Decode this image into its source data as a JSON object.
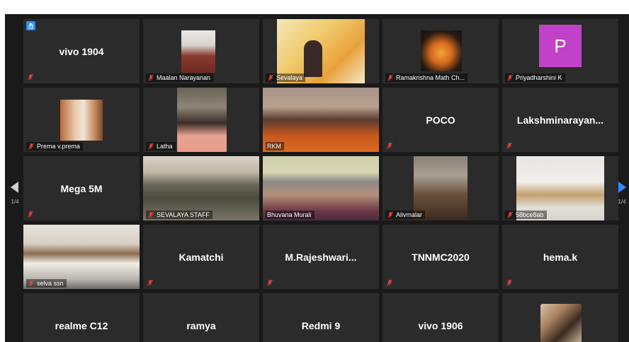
{
  "pager": {
    "left_page": "1/4",
    "right_page": "1/4"
  },
  "colors": {
    "active_border": "#e8e84a",
    "muted_mic": "#e0433e",
    "hand_badge": "#2d8cff",
    "avatar_p": "#c142c8"
  },
  "tiles": {
    "vivo1904": {
      "name": "vivo 1904"
    },
    "maalan": {
      "name": "Maalan Narayanan"
    },
    "sevalaya": {
      "name": "Sevalaya"
    },
    "ramakrishna": {
      "name": "Ramakrishna Math Ch..."
    },
    "priyadharshini": {
      "name": "Priyadharshini K",
      "initial": "P"
    },
    "prema": {
      "name": "Prema v.prema"
    },
    "latha": {
      "name": "Latha"
    },
    "rkm": {
      "name": "RKM"
    },
    "poco": {
      "name": "POCO"
    },
    "lakshmi": {
      "name": "Lakshminarayan..."
    },
    "mega": {
      "name": "Mega 5M"
    },
    "staff": {
      "name": "SEVALAYA STAFF"
    },
    "bhuvana": {
      "name": "Bhuvana Murali"
    },
    "alivmalar": {
      "name": "Alivmalar"
    },
    "fiftyeight": {
      "name": "58bce8ab"
    },
    "selva": {
      "name": "selva ssn"
    },
    "kamatchi": {
      "name": "Kamatchi"
    },
    "rajeshwari": {
      "name": "M.Rajeshwari..."
    },
    "tnnmc": {
      "name": "TNNMC2020"
    },
    "hema": {
      "name": "hema.k"
    },
    "realme": {
      "name": "realme C12"
    },
    "ramya": {
      "name": "ramya"
    },
    "redmi": {
      "name": "Redmi 9"
    },
    "vivo1906": {
      "name": "vivo 1906"
    }
  }
}
